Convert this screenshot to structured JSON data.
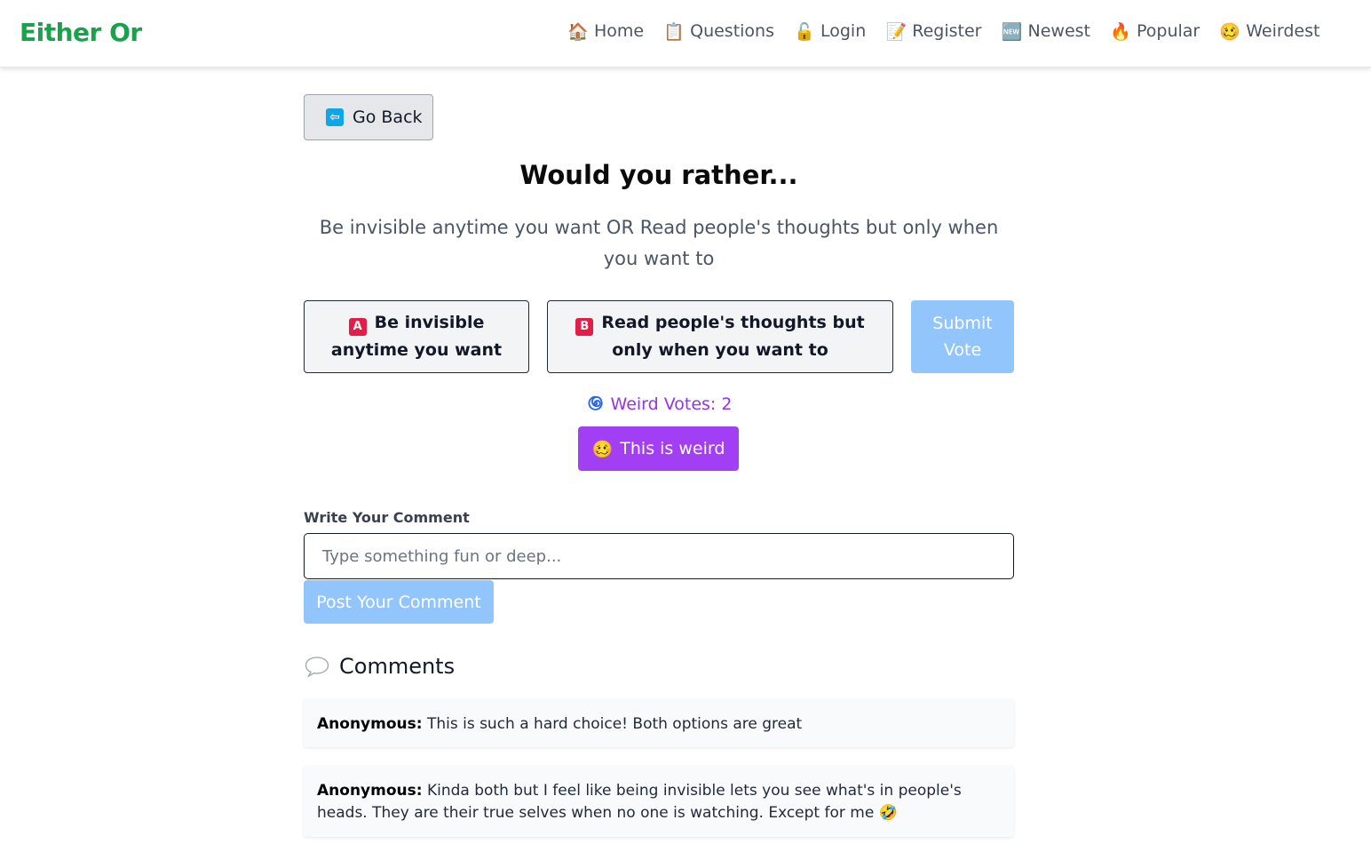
{
  "brand": "Either Or",
  "nav": [
    {
      "label": "Home",
      "icon": "house-icon",
      "glyph": "🏠"
    },
    {
      "label": "Questions",
      "icon": "clipboard-icon",
      "glyph": "📋"
    },
    {
      "label": "Login",
      "icon": "lock-icon",
      "glyph": "🔓"
    },
    {
      "label": "Register",
      "icon": "memo-icon",
      "glyph": "📝"
    },
    {
      "label": "Newest",
      "icon": "new-badge-icon",
      "glyph": "🆕"
    },
    {
      "label": "Popular",
      "icon": "fire-icon",
      "glyph": "🔥"
    },
    {
      "label": "Weirdest",
      "icon": "woozy-face-icon",
      "glyph": "🥴"
    }
  ],
  "back_button": "Go Back",
  "title": "Would you rather...",
  "question": "Be invisible anytime you want OR Read people's thoughts but only when you want to",
  "options": {
    "a": {
      "letter": "A",
      "label": "Be invisible anytime you want"
    },
    "b": {
      "letter": "B",
      "label": "Read people's thoughts but only when you want to"
    }
  },
  "submit_label": "Submit Vote",
  "weird": {
    "count_text": "Weird Votes: 2",
    "button_label": "This is weird",
    "button_glyph": "🥴"
  },
  "comment_form": {
    "label": "Write Your Comment",
    "placeholder": "Type something fun or deep...",
    "value": "",
    "post_label": "Post Your Comment"
  },
  "comments_heading": "Comments",
  "comments": [
    {
      "author": "Anonymous:",
      "text": " This is such a hard choice! Both options are great"
    },
    {
      "author": "Anonymous:",
      "text": " Kinda both but I feel like being invisible lets you see what's in people's heads. They are their true selves when no one is watching. Except for me 🤣"
    }
  ],
  "colors": {
    "brand": "#16a34a",
    "accent_weird": "#a23ff4",
    "disabled_blue": "#93c5fd",
    "option_letter": "#e11d48"
  }
}
